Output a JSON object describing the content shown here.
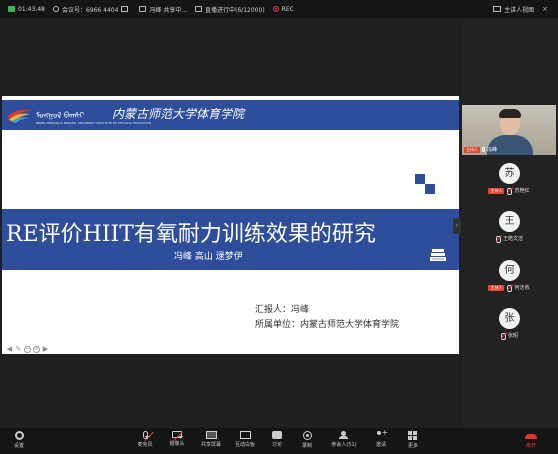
{
  "topbar": {
    "time": "01:43:48",
    "meeting_id": "会议号：6966 4404",
    "sharing": "冯峰 共享中...",
    "stream": "直播进行中(6/12000)",
    "rec": "REC",
    "speaker_view": "主讲人视图",
    "close": "×"
  },
  "slide": {
    "logo_mongol": "ᠮᠣᠩᠭᠣᠯ ᠪᠠᠭᠰᠢ",
    "logo_cn": "内蒙古师范大学体育学院",
    "logo_en": "INNER MONGOLIA NORMAL UNIVERSITY INSTITUTE OF PHYSICAL EDUCATION",
    "title": "RE评价HIIT有氧耐力训练效果的研究",
    "authors": "冯峰  高山  逯梦伊",
    "reporter": "汇报人：冯峰",
    "unit": "所属单位：内蒙古师范大学体育学院"
  },
  "self_video": {
    "badge": "主持人",
    "name": "冯峰"
  },
  "participants": [
    {
      "avatar": "苏",
      "badge": "主持人",
      "name": "苏艳红"
    },
    {
      "avatar": "王",
      "badge": "",
      "name": "王皓文洁"
    },
    {
      "avatar": "何",
      "badge": "主持人",
      "name": "何洁依"
    },
    {
      "avatar": "张",
      "badge": "",
      "name": "张昭"
    }
  ],
  "toolbar": {
    "settings": "设置",
    "mic": "麦克风",
    "camera": "摄像头",
    "share": "共享屏幕",
    "whiteboard": "互动白板",
    "chat": "讨论",
    "record": "录制",
    "participants": "参会人(51)",
    "invite": "邀请",
    "more": "更多",
    "leave": "离开"
  },
  "colors": {
    "slide_blue": "#2e4e9c",
    "leave_red": "#e0352b",
    "host_badge": "#e4442f"
  }
}
